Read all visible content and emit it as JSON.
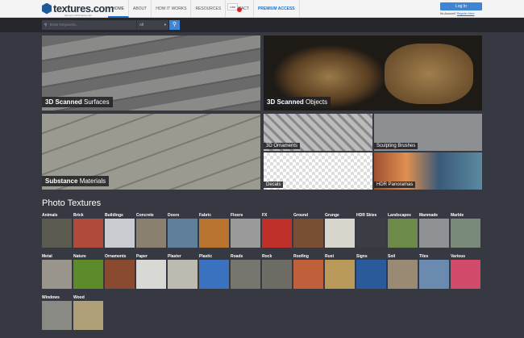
{
  "header": {
    "logo": "textures.com",
    "logo_sub": "formerly CGTextures.com",
    "nav": [
      "HOME",
      "ABOUT",
      "HOW IT WORKS",
      "RESOURCES",
      "CONTACT",
      "PREMIUM ACCESS"
    ],
    "like": "Like",
    "login": "Log In",
    "no_account": "No Account?",
    "register": "Register Here"
  },
  "search": {
    "placeholder": "Enter Keywords...",
    "select": "All"
  },
  "hero": [
    {
      "strong": "3D Scanned",
      "rest": " Surfaces"
    },
    {
      "strong": "3D Scanned",
      "rest": " Objects"
    },
    {
      "strong": "Substance",
      "rest": " Materials"
    },
    {
      "label": "3D Ornaments"
    },
    {
      "label": "Sculpting Brushes"
    },
    {
      "label": "Decals"
    },
    {
      "label": "HDR Panoramas"
    }
  ],
  "section_title": "Photo Textures",
  "categories": [
    {
      "label": "Animals",
      "color": "#5a5b4e"
    },
    {
      "label": "Brick",
      "color": "#b04a3a"
    },
    {
      "label": "Buildings",
      "color": "#c8ccd0"
    },
    {
      "label": "Concrete",
      "color": "#8a8070"
    },
    {
      "label": "Doors",
      "color": "#5f7f9a"
    },
    {
      "label": "Fabric",
      "color": "#b9752f"
    },
    {
      "label": "Floors",
      "color": "#9a9a9a"
    },
    {
      "label": "FX",
      "color": "#c0302a"
    },
    {
      "label": "Ground",
      "color": "#7a4e35"
    },
    {
      "label": "Grunge",
      "color": "#d8d6cc"
    },
    {
      "label": "HDR Skies",
      "color": "#3a3d44"
    },
    {
      "label": "Landscapes",
      "color": "#6e8a4a"
    },
    {
      "label": "Manmade",
      "color": "#8e9294"
    },
    {
      "label": "Marble",
      "color": "#7a8a78"
    },
    {
      "label": "Metal",
      "color": "#9a958c"
    },
    {
      "label": "Nature",
      "color": "#5d8a2a"
    },
    {
      "label": "Ornaments",
      "color": "#8a4a30"
    },
    {
      "label": "Paper",
      "color": "#d8d8d4"
    },
    {
      "label": "Plaster",
      "color": "#bdbab0"
    },
    {
      "label": "Plastic",
      "color": "#3a72c0"
    },
    {
      "label": "Roads",
      "color": "#76756e"
    },
    {
      "label": "Rock",
      "color": "#6d6d66"
    },
    {
      "label": "Roofing",
      "color": "#c0603a"
    },
    {
      "label": "Rust",
      "color": "#b99a5a"
    },
    {
      "label": "Signs",
      "color": "#2a5a9a"
    },
    {
      "label": "Soil",
      "color": "#9a8a74"
    },
    {
      "label": "Tiles",
      "color": "#6a8ab0"
    },
    {
      "label": "Various",
      "color": "#d04a6a"
    },
    {
      "label": "Windows",
      "color": "#8a8a84"
    },
    {
      "label": "Wood",
      "color": "#b0a07a"
    }
  ]
}
